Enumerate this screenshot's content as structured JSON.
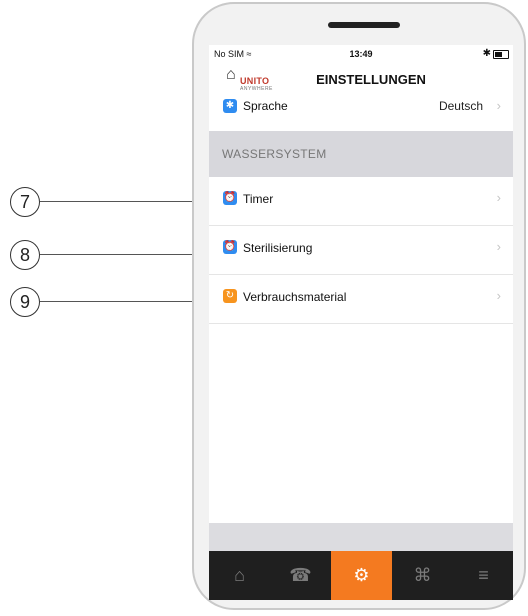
{
  "callouts": [
    "7",
    "8",
    "9"
  ],
  "status": {
    "carrier": "No SIM",
    "time": "13:49"
  },
  "header": {
    "logo_brand": "UNITO",
    "logo_tag": "ANYWHERE",
    "title": "EINSTELLUNGEN"
  },
  "language_row": {
    "label": "Sprache",
    "value": "Deutsch"
  },
  "section": {
    "title": "WASSERSYSTEM"
  },
  "items": [
    {
      "label": "Timer",
      "icon": "alarm-clock-icon",
      "color": "#2f8cf0"
    },
    {
      "label": "Sterilisierung",
      "icon": "alarm-clock-icon",
      "color": "#2f8cf0"
    },
    {
      "label": "Verbrauchsmaterial",
      "icon": "refresh-icon",
      "color": "#f7941e"
    }
  ],
  "tabs": [
    "home",
    "phone",
    "settings",
    "cart",
    "statistics"
  ],
  "colors": {
    "accent": "#f47a20",
    "tabbar": "#1f1f1f",
    "blue_icon": "#2f8cf0"
  }
}
